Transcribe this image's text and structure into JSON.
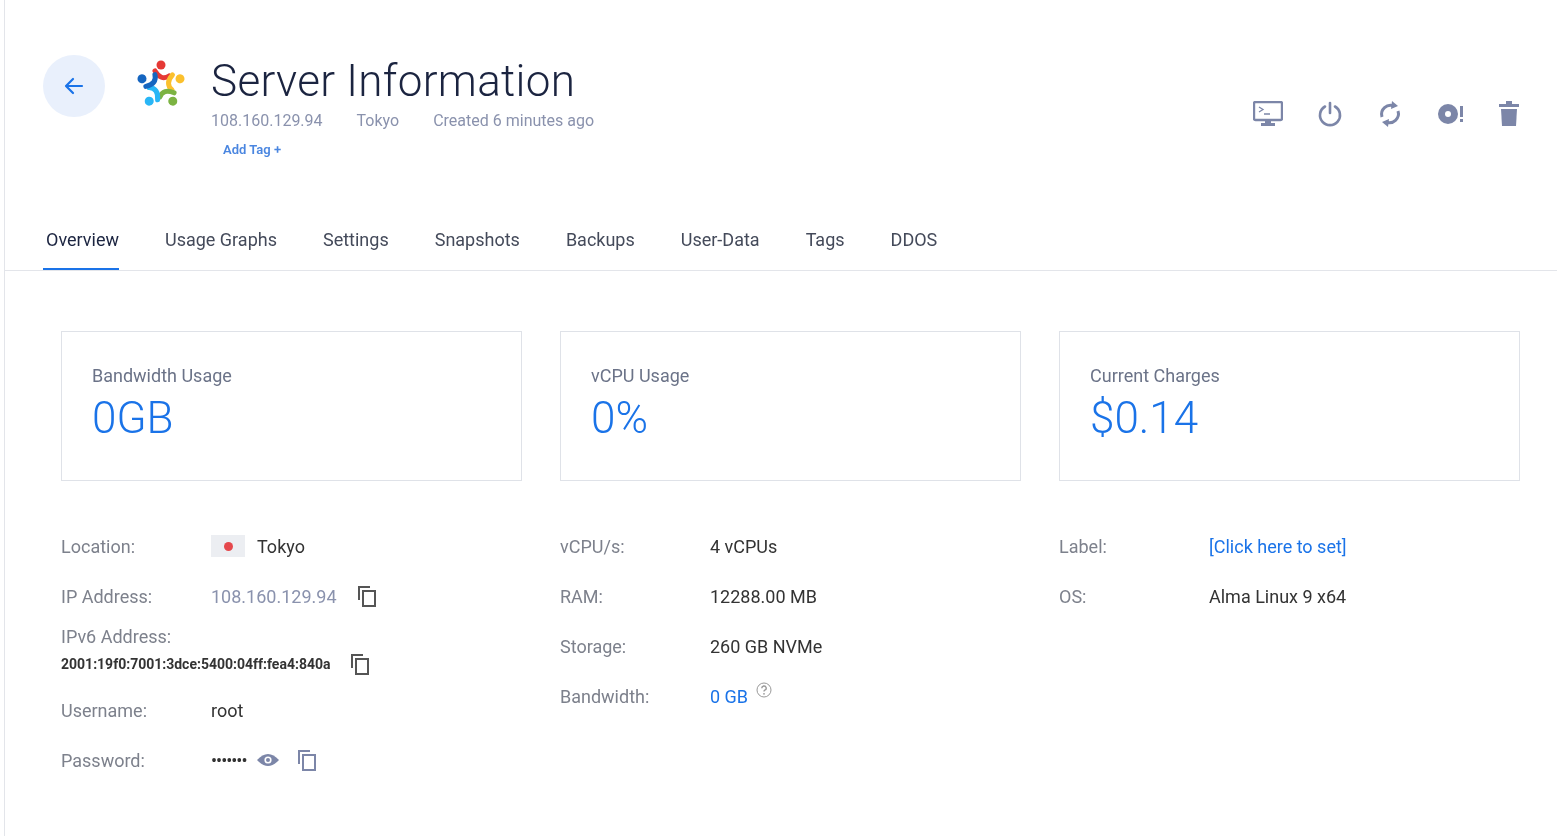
{
  "header": {
    "title": "Server Information",
    "meta": [
      "108.160.129.94",
      "Tokyo",
      "Created 6 minutes ago"
    ],
    "add_tag": "Add Tag +"
  },
  "tabs": [
    {
      "label": "Overview",
      "selected": true
    },
    {
      "label": "Usage Graphs",
      "selected": false
    },
    {
      "label": "Settings",
      "selected": false
    },
    {
      "label": "Snapshots",
      "selected": false
    },
    {
      "label": "Backups",
      "selected": false
    },
    {
      "label": "User-Data",
      "selected": false
    },
    {
      "label": "Tags",
      "selected": false
    },
    {
      "label": "DDOS",
      "selected": false
    }
  ],
  "stats": [
    {
      "title": "Bandwidth Usage",
      "value": "0GB"
    },
    {
      "title": "vCPU Usage",
      "value": "0%"
    },
    {
      "title": "Current Charges",
      "value": "$0.14"
    }
  ],
  "details": [
    [
      {
        "label": "Location:",
        "value": "Tokyo",
        "kind": "flag"
      },
      {
        "label": "IP Address:",
        "value": "108.160.129.94",
        "kind": "muted",
        "copyable": true
      },
      {
        "label": "IPv6 Address:",
        "value": "2001:19f0:7001:3dce:5400:04ff:fea4:840a",
        "kind": "stacked",
        "copyable": true
      },
      {
        "label": "Username:",
        "value": "root",
        "kind": "plain"
      },
      {
        "label": "Password:",
        "value": "•••••••",
        "kind": "password",
        "copyable": true
      }
    ],
    [
      {
        "label": "vCPU/s:",
        "value": "4 vCPUs",
        "kind": "plain"
      },
      {
        "label": "RAM:",
        "value": "12288.00 MB",
        "kind": "plain"
      },
      {
        "label": "Storage:",
        "value": "260 GB NVMe",
        "kind": "plain"
      },
      {
        "label": "Bandwidth:",
        "value": "0 GB",
        "kind": "help"
      }
    ],
    [
      {
        "label": "Label:",
        "value": "[Click here to set]",
        "kind": "link"
      },
      {
        "label": "OS:",
        "value": "Alma Linux 9 x64",
        "kind": "plain"
      }
    ]
  ]
}
